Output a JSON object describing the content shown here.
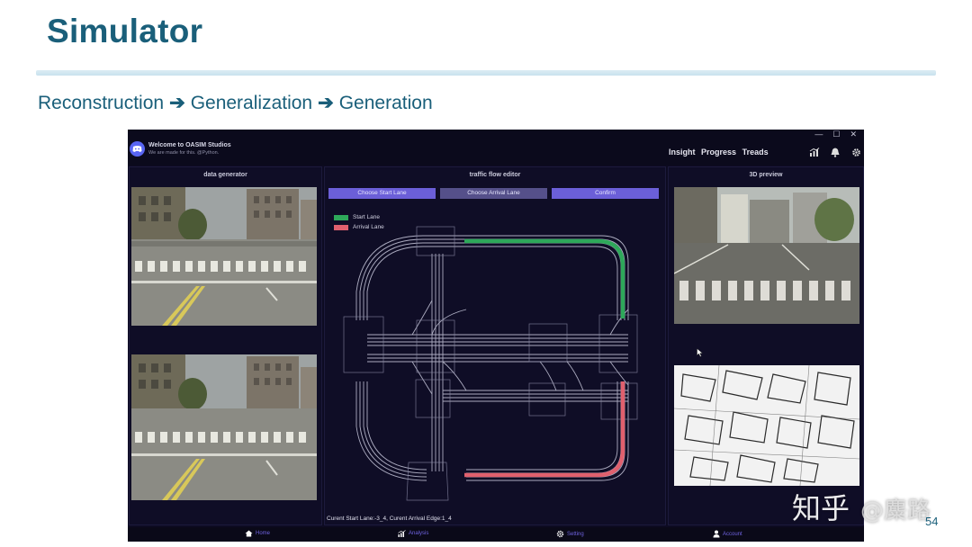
{
  "slide": {
    "title": "Simulator",
    "subtitle_parts": [
      "Reconstruction",
      "Generalization",
      "Generation"
    ],
    "arrow": "➔",
    "page_number": "54",
    "watermark": "知乎",
    "watermark_handle": "@麋路",
    "accent_color": "#1a5f7a"
  },
  "app": {
    "name": "Welcome to OASIM Studios",
    "tagline": "We are made for this. @Python.",
    "window_controls": [
      "—",
      "☐",
      "✕"
    ],
    "nav": [
      "Insight",
      "Progress",
      "Treads"
    ],
    "icons": [
      "chart-icon",
      "bell-icon",
      "gear-icon"
    ],
    "panels": {
      "left": "data generator",
      "center": "traffic flow editor",
      "right": "3D preview"
    },
    "buttons": {
      "start": "Choose Start Lane",
      "arrival": "Choose Arrival Lane",
      "confirm": "Confirm"
    },
    "legend": [
      {
        "label": "Start Lane",
        "color": "#2ea85a"
      },
      {
        "label": "Arrival Lane",
        "color": "#e0606e"
      }
    ],
    "status": "Curent Start Lane:-3_4, Curent Arrival Edge:1_4",
    "bottom_nav": [
      "Home",
      "Analysis",
      "Setting",
      "Account"
    ]
  }
}
